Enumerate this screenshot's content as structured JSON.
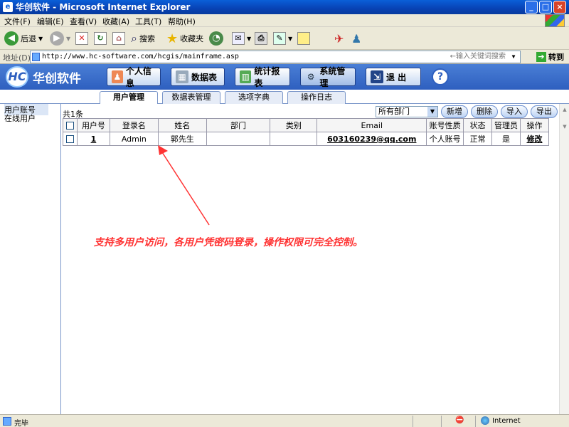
{
  "window": {
    "title": "华创软件 - Microsoft Internet Explorer"
  },
  "menu": [
    "文件(F)",
    "编辑(E)",
    "查看(V)",
    "收藏(A)",
    "工具(T)",
    "帮助(H)"
  ],
  "toolbar": {
    "back": "后退",
    "search": "搜索",
    "favorites": "收藏夹"
  },
  "address": {
    "label": "地址(D)",
    "url": "http://www.hc-software.com/hcgis/mainframe.asp",
    "keyword_placeholder": "←输入关键词搜索",
    "go": "转到"
  },
  "app": {
    "brand": "华创软件",
    "nav": [
      "个人信息",
      "数据表",
      "统计报表",
      "系统管理",
      "退 出"
    ],
    "help": "?"
  },
  "tabs": [
    "用户管理",
    "数据表管理",
    "选项字典",
    "操作日志"
  ],
  "sidebar": [
    "用户账号",
    "在线用户"
  ],
  "list": {
    "count": "共1条",
    "department": "所有部门",
    "actions": [
      "新增",
      "删除",
      "导入",
      "导出"
    ],
    "columns": [
      "用户号",
      "登录名",
      "姓名",
      "部门",
      "类别",
      "Email",
      "账号性质",
      "状态",
      "管理员",
      "操作"
    ],
    "rows": [
      {
        "id": "1",
        "login": "Admin",
        "name": "郭先生",
        "dept": "",
        "category": "",
        "email": "603160239@qq.com",
        "account_type": "个人账号",
        "status": "正常",
        "admin": "是",
        "op": "修改"
      }
    ]
  },
  "annotation": "支持多用户访问，各用户凭密码登录，操作权限可完全控制。",
  "status": {
    "text": "完毕",
    "zone": "Internet"
  },
  "colors": {
    "annotation": "#ff3333",
    "header": "#2e5fbf"
  }
}
